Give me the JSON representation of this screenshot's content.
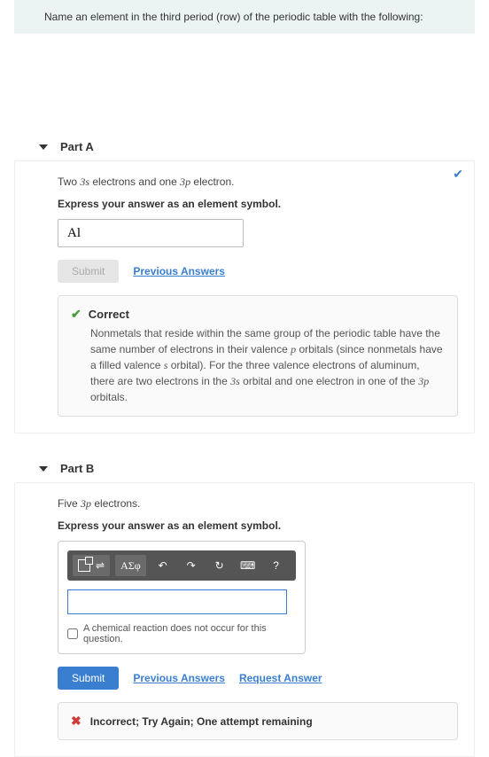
{
  "question": {
    "prompt": "Name an element in the third period (row) of the periodic table with the following:"
  },
  "partA": {
    "title": "Part A",
    "prompt_pre": "Two ",
    "prompt_s1": "3s",
    "prompt_mid": " electrons and one ",
    "prompt_s2": "3p",
    "prompt_post": " electron.",
    "instruction": "Express your answer as an element symbol.",
    "answer_value": "Al",
    "submit_label": "Submit",
    "prev_answers": "Previous Answers",
    "feedback": {
      "title": "Correct",
      "t1": "Nonmetals that reside within the same group of the periodic table have the same number of electrons in their valence ",
      "p": "p",
      "t2": " orbitals (since nonmetals have a filled valence ",
      "s": "s",
      "t3": " orbital). For the three valence electrons of aluminum, there are two electrons in the ",
      "s3": "3s",
      "t4": " orbital and one electron in one of the ",
      "p3": "3p",
      "t5": " orbitals."
    }
  },
  "partB": {
    "title": "Part B",
    "prompt_pre": "Five ",
    "prompt_s1": "3p",
    "prompt_post": " electrons.",
    "instruction": "Express your answer as an element symbol.",
    "toolbar": {
      "greek": "ΑΣφ",
      "help": "?"
    },
    "no_reaction": "A chemical reaction does not occur for this question.",
    "submit_label": "Submit",
    "prev_answers": "Previous Answers",
    "request_answer": "Request Answer",
    "incorrect": "Incorrect; Try Again; One attempt remaining"
  }
}
